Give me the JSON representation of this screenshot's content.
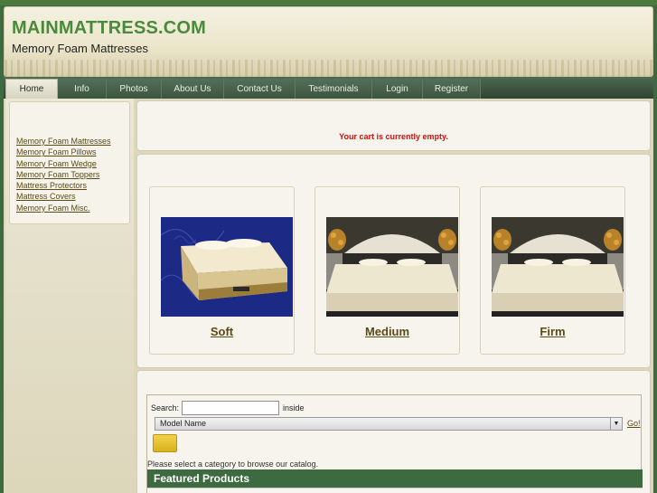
{
  "header": {
    "site_name": "MAINMATTRESS.COM",
    "tagline": "Memory Foam Mattresses"
  },
  "nav": {
    "items": [
      {
        "label": "Home",
        "active": true
      },
      {
        "label": "Info",
        "active": false
      },
      {
        "label": "Photos",
        "active": false
      },
      {
        "label": "About Us",
        "active": false
      },
      {
        "label": "Contact Us",
        "active": false
      },
      {
        "label": "Testimonials",
        "active": false
      },
      {
        "label": "Login",
        "active": false
      },
      {
        "label": "Register",
        "active": false
      }
    ]
  },
  "sidebar": {
    "categories": [
      "Memory Foam Mattresses",
      "Memory Foam Pillows",
      "Memory Foam Wedge",
      "Memory Foam Toppers",
      "Mattress Protectors",
      "Mattress Covers",
      "Memory Foam Misc."
    ]
  },
  "cart": {
    "message": "Your cart is currently empty."
  },
  "products": [
    {
      "label": "Soft"
    },
    {
      "label": "Medium"
    },
    {
      "label": "Firm"
    }
  ],
  "search": {
    "label": "Search:",
    "input_value": "",
    "inside_label": "inside",
    "select_value": "Model Name",
    "go_label": "Go!",
    "browse_message": "Please select a category to browse our catalog.",
    "featured_title": "Featured Products"
  },
  "colors": {
    "brand_green": "#4a8a3a",
    "nav_green": "#3d6b3f",
    "cart_red": "#d11010",
    "link_brown": "#5b4a16",
    "button_yellow": "#e6c330"
  }
}
